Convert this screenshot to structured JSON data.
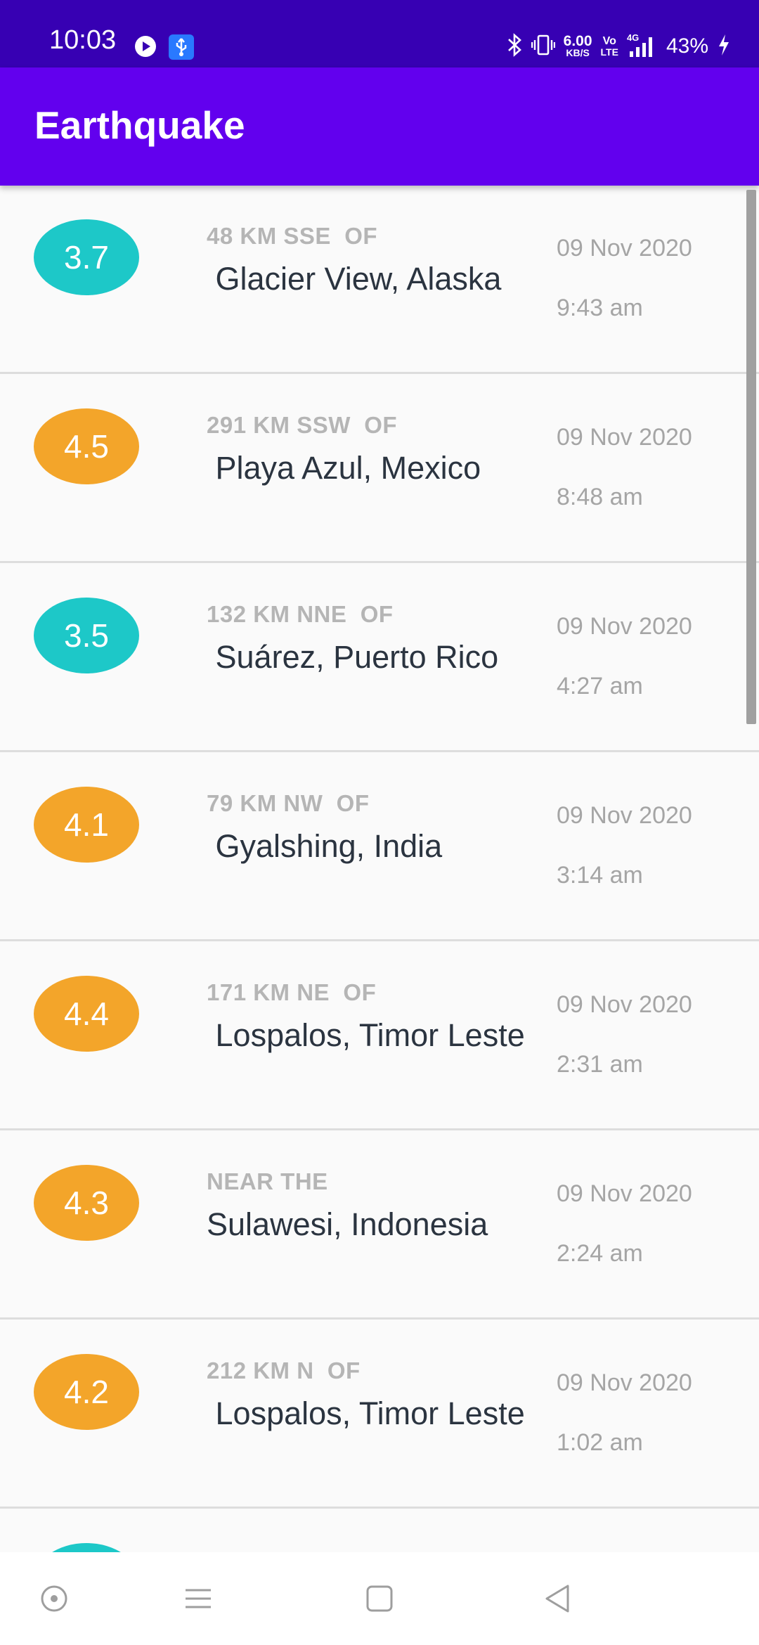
{
  "status_bar": {
    "time": "10:03",
    "network_speed_value": "6.00",
    "network_speed_unit": "KB/S",
    "volte_top": "Vo",
    "volte_bottom": "LTE",
    "network_type": "4G",
    "battery_percent": "43%",
    "icons": [
      "play-icon",
      "usb-icon",
      "bluetooth-icon",
      "vibrate-icon",
      "signal-icon",
      "charging-icon"
    ]
  },
  "app_bar": {
    "title": "Earthquake"
  },
  "colors": {
    "status_bar": "#3700b3",
    "app_bar": "#6200ee",
    "mag_low": "#1dc8c8",
    "mag_high": "#f3a52a"
  },
  "earthquakes": [
    {
      "magnitude": "3.7",
      "level": "low",
      "offset": "48 KM SSE  OF",
      "primary": " Glacier View, Alaska",
      "date": "09 Nov 2020",
      "time": "9:43 am"
    },
    {
      "magnitude": "4.5",
      "level": "high",
      "offset": "291 KM SSW  OF",
      "primary": " Playa Azul, Mexico",
      "date": "09 Nov 2020",
      "time": "8:48 am"
    },
    {
      "magnitude": "3.5",
      "level": "low",
      "offset": "132 KM NNE  OF",
      "primary": " Suárez, Puerto Rico",
      "date": "09 Nov 2020",
      "time": "4:27 am"
    },
    {
      "magnitude": "4.1",
      "level": "high",
      "offset": "79 KM NW  OF",
      "primary": " Gyalshing, India",
      "date": "09 Nov 2020",
      "time": "3:14 am"
    },
    {
      "magnitude": "4.4",
      "level": "high",
      "offset": "171 KM NE  OF",
      "primary": " Lospalos, Timor Leste",
      "date": "09 Nov 2020",
      "time": "2:31 am"
    },
    {
      "magnitude": "4.3",
      "level": "high",
      "offset": "NEAR THE",
      "primary": "Sulawesi, Indonesia",
      "date": "09 Nov 2020",
      "time": "2:24 am"
    },
    {
      "magnitude": "4.2",
      "level": "high",
      "offset": "212 KM N  OF",
      "primary": " Lospalos, Timor Leste",
      "date": "09 Nov 2020",
      "time": "1:02 am"
    },
    {
      "magnitude": "",
      "level": "low",
      "offset": "",
      "primary": "",
      "date": "",
      "time": ""
    }
  ],
  "nav_bar": {
    "buttons": [
      "assistant-icon",
      "menu-icon",
      "home-square-icon",
      "back-triangle-icon"
    ]
  }
}
